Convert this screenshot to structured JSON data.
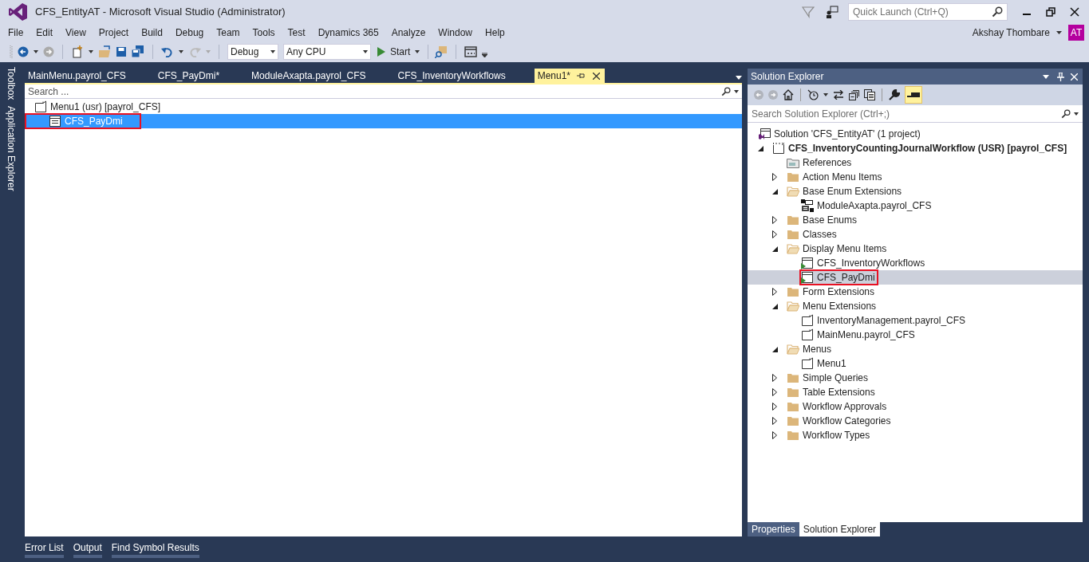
{
  "window": {
    "title": "CFS_EntityAT - Microsoft Visual Studio (Administrator)"
  },
  "quick_launch": {
    "placeholder": "Quick Launch (Ctrl+Q)"
  },
  "user": {
    "name": "Akshay Thombare",
    "initials": "AT"
  },
  "menu": [
    "File",
    "Edit",
    "View",
    "Project",
    "Build",
    "Debug",
    "Team",
    "Tools",
    "Test",
    "Dynamics 365",
    "Analyze",
    "Window",
    "Help"
  ],
  "toolbar": {
    "configuration": "Debug",
    "platform": "Any CPU",
    "start": "Start"
  },
  "side_tabs": [
    "Toolbox",
    "Application Explorer"
  ],
  "document_tabs": [
    {
      "label": "MainMenu.payrol_CFS",
      "selected": false
    },
    {
      "label": "CFS_PayDmi*",
      "selected": false
    },
    {
      "label": "ModuleAxapta.payrol_CFS",
      "selected": false
    },
    {
      "label": "CFS_InventoryWorkflows",
      "selected": false
    },
    {
      "label": "Menu1*",
      "selected": true
    }
  ],
  "designer": {
    "search": {
      "placeholder": "Search ..."
    },
    "tree": [
      {
        "label": "Menu1 (usr) [payrol_CFS]",
        "kind": "menu",
        "selected": false,
        "highlighted": false,
        "children": [
          {
            "label": "CFS_PayDmi",
            "kind": "menu-item-ref",
            "selected": true,
            "highlighted": true
          }
        ]
      }
    ]
  },
  "solution_explorer": {
    "title": "Solution Explorer",
    "search": {
      "placeholder": "Search Solution Explorer (Ctrl+;)"
    },
    "tree": [
      {
        "label": "Solution 'CFS_EntityAT' (1 project)",
        "kind": "solution",
        "selected": false,
        "highlighted": false,
        "children": [
          {
            "label": "CFS_InventoryCountingJournalWorkflow (USR) [payrol_CFS]",
            "kind": "project",
            "expanded": true,
            "selected": false,
            "highlighted": false,
            "children": [
              {
                "label": "References",
                "kind": "references",
                "selected": false,
                "highlighted": false
              },
              {
                "label": "Action Menu Items",
                "kind": "folder",
                "expanded": false,
                "selected": false,
                "highlighted": false
              },
              {
                "label": "Base Enum Extensions",
                "kind": "folder",
                "expanded": true,
                "selected": false,
                "highlighted": false,
                "children": [
                  {
                    "label": "ModuleAxapta.payrol_CFS",
                    "kind": "enum-extension",
                    "selected": false,
                    "highlighted": false
                  }
                ]
              },
              {
                "label": "Base Enums",
                "kind": "folder",
                "expanded": false,
                "selected": false,
                "highlighted": false
              },
              {
                "label": "Classes",
                "kind": "folder",
                "expanded": false,
                "selected": false,
                "highlighted": false
              },
              {
                "label": "Display Menu Items",
                "kind": "folder",
                "expanded": true,
                "selected": false,
                "highlighted": false,
                "children": [
                  {
                    "label": "CFS_InventoryWorkflows",
                    "kind": "menu-item",
                    "selected": false,
                    "highlighted": false
                  },
                  {
                    "label": "CFS_PayDmi",
                    "kind": "menu-item",
                    "selected": true,
                    "highlighted": true
                  }
                ]
              },
              {
                "label": "Form Extensions",
                "kind": "folder",
                "expanded": false,
                "selected": false,
                "highlighted": false
              },
              {
                "label": "Menu Extensions",
                "kind": "folder",
                "expanded": true,
                "selected": false,
                "highlighted": false,
                "children": [
                  {
                    "label": "InventoryManagement.payrol_CFS",
                    "kind": "menu",
                    "selected": false,
                    "highlighted": false
                  },
                  {
                    "label": "MainMenu.payrol_CFS",
                    "kind": "menu",
                    "selected": false,
                    "highlighted": false
                  }
                ]
              },
              {
                "label": "Menus",
                "kind": "folder",
                "expanded": true,
                "selected": false,
                "highlighted": false,
                "children": [
                  {
                    "label": "Menu1",
                    "kind": "menu",
                    "selected": false,
                    "highlighted": false
                  }
                ]
              },
              {
                "label": "Simple Queries",
                "kind": "folder",
                "expanded": false,
                "selected": false,
                "highlighted": false
              },
              {
                "label": "Table Extensions",
                "kind": "folder",
                "expanded": false,
                "selected": false,
                "highlighted": false
              },
              {
                "label": "Workflow Approvals",
                "kind": "folder",
                "expanded": false,
                "selected": false,
                "highlighted": false
              },
              {
                "label": "Workflow Categories",
                "kind": "folder",
                "expanded": false,
                "selected": false,
                "highlighted": false
              },
              {
                "label": "Workflow Types",
                "kind": "folder",
                "expanded": false,
                "selected": false,
                "highlighted": false
              }
            ]
          }
        ]
      }
    ]
  },
  "panel_tabs": [
    {
      "label": "Properties",
      "selected": false
    },
    {
      "label": "Solution Explorer",
      "selected": true
    }
  ],
  "bottom_tabs": [
    "Error List",
    "Output",
    "Find Symbol Results"
  ]
}
